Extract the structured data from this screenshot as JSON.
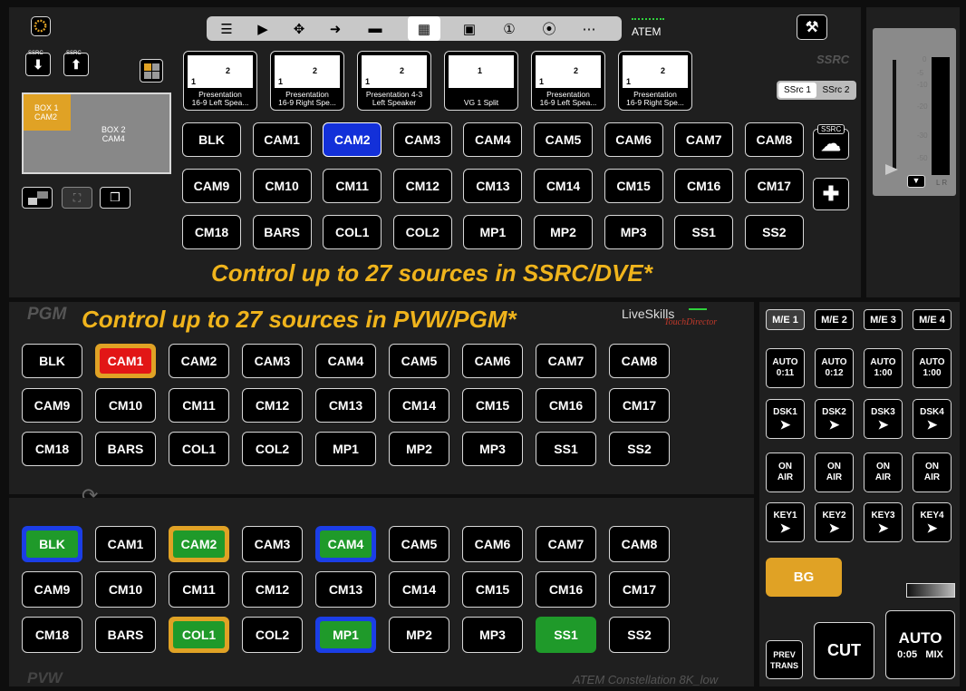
{
  "toolbar": {
    "atem_label": "ATEM"
  },
  "ssrc_panel": {
    "title": "SSRC",
    "ssrc_toggle": [
      "SSrc 1",
      "SSrc 2"
    ],
    "ssrc_small_label": "SSRC",
    "preview_box1": "BOX 1\nCAM2",
    "preview_box2": "BOX 2\nCAM4",
    "presets": [
      {
        "label": "Presentation\n16-9 Left Spea...",
        "a": "1",
        "b": "2"
      },
      {
        "label": "Presentation\n16-9 Right Spe...",
        "a": "1",
        "b": "2"
      },
      {
        "label": "Presentation 4-3\nLeft Speaker",
        "a": "1",
        "b": "2"
      },
      {
        "label": "VG 1 Split",
        "a": "1",
        "b": ""
      },
      {
        "label": "Presentation\n16-9 Left Spea...",
        "a": "1",
        "b": "2"
      },
      {
        "label": "Presentation\n16-9 Right Spe...",
        "a": "1",
        "b": "2"
      }
    ],
    "sources": [
      [
        "BLK",
        "CAM1",
        "CAM2",
        "CAM3",
        "CAM4",
        "CAM5",
        "CAM6",
        "CAM7",
        "CAM8"
      ],
      [
        "CAM9",
        "CM10",
        "CM11",
        "CM12",
        "CM13",
        "CM14",
        "CM15",
        "CM16",
        "CM17"
      ],
      [
        "CM18",
        "BARS",
        "COL1",
        "COL2",
        "MP1",
        "MP2",
        "MP3",
        "SS1",
        "SS2"
      ]
    ],
    "banner": "Control up to 27 sources in SSRC/DVE*"
  },
  "audio_meter": {
    "ticks": [
      "0",
      "-5",
      "-10",
      "-20",
      "-30",
      "-50"
    ],
    "lr": "L R"
  },
  "pgm": {
    "title": "PGM",
    "banner": "Control up to 27 sources in PVW/PGM*",
    "brand": "LiveSkills",
    "brand_sub": "TouchDirector",
    "sources": [
      [
        "BLK",
        "CAM1",
        "CAM2",
        "CAM3",
        "CAM4",
        "CAM5",
        "CAM6",
        "CAM7",
        "CAM8"
      ],
      [
        "CAM9",
        "CM10",
        "CM11",
        "CM12",
        "CM13",
        "CM14",
        "CM15",
        "CM16",
        "CM17"
      ],
      [
        "CM18",
        "BARS",
        "COL1",
        "COL2",
        "MP1",
        "MP2",
        "MP3",
        "SS1",
        "SS2"
      ]
    ]
  },
  "pvw": {
    "title": "PVW",
    "footer": "ATEM Constellation 8K_low",
    "sources": [
      [
        "BLK",
        "CAM1",
        "CAM2",
        "CAM3",
        "CAM4",
        "CAM5",
        "CAM6",
        "CAM7",
        "CAM8"
      ],
      [
        "CAM9",
        "CM10",
        "CM11",
        "CM12",
        "CM13",
        "CM14",
        "CM15",
        "CM16",
        "CM17"
      ],
      [
        "CM18",
        "BARS",
        "COL1",
        "COL2",
        "MP1",
        "MP2",
        "MP3",
        "SS1",
        "SS2"
      ]
    ]
  },
  "me": {
    "tabs": [
      "M/E 1",
      "M/E 2",
      "M/E 3",
      "M/E 4"
    ],
    "auto": [
      [
        "AUTO",
        "0:11"
      ],
      [
        "AUTO",
        "0:12"
      ],
      [
        "AUTO",
        "1:00"
      ],
      [
        "AUTO",
        "1:00"
      ]
    ],
    "dsk": [
      "DSK1",
      "DSK2",
      "DSK3",
      "DSK4"
    ],
    "onair": [
      [
        "ON",
        "AIR"
      ],
      [
        "ON",
        "AIR"
      ],
      [
        "ON",
        "AIR"
      ],
      [
        "ON",
        "AIR"
      ]
    ],
    "key": [
      "KEY1",
      "KEY2",
      "KEY3",
      "KEY4"
    ],
    "bg": "BG",
    "prev_trans": [
      "PREV",
      "TRANS"
    ],
    "cut": "CUT",
    "auto_main": "AUTO",
    "auto_time": "0:05",
    "auto_mix": "MIX"
  }
}
